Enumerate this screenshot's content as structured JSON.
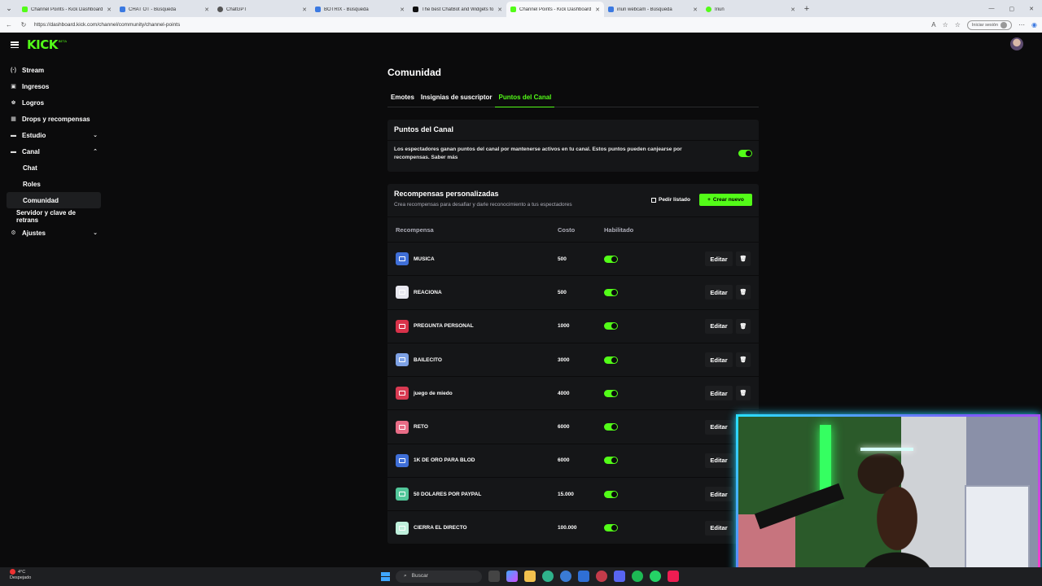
{
  "browser": {
    "tabs": [
      {
        "title": "Channel Points - Kick Dashboard",
        "icon": "kick"
      },
      {
        "title": "CHAT OT - Búsqueda",
        "icon": "bing"
      },
      {
        "title": "ChatGPT",
        "icon": "gpt"
      },
      {
        "title": "BOTRIX - Búsqueda",
        "icon": "bing"
      },
      {
        "title": "The best ChatBot and Widgets fo",
        "icon": "chat"
      },
      {
        "title": "Channel Points - Kick Dashboard",
        "icon": "kick",
        "active": true
      },
      {
        "title": "iriun webcam - Búsqueda",
        "icon": "bing"
      },
      {
        "title": "Iriun",
        "icon": "dot"
      }
    ],
    "url": "https://dashboard.kick.com/channel/community/channel-points",
    "signin_label": "Iniciar sesión"
  },
  "app": {
    "logo": "KICK",
    "logo_badge": "BETA"
  },
  "sidebar": {
    "items": [
      {
        "label": "Stream",
        "icon": "stream-icon",
        "glyph": "((·))"
      },
      {
        "label": "Ingresos",
        "icon": "revenue-icon",
        "glyph": "▣"
      },
      {
        "label": "Logros",
        "icon": "trophy-icon",
        "glyph": "🏆"
      },
      {
        "label": "Drops y recompensas",
        "icon": "drops-icon",
        "glyph": "▦"
      },
      {
        "label": "Estudio",
        "icon": "studio-icon",
        "glyph": "▬",
        "chevron": "down"
      },
      {
        "label": "Canal",
        "icon": "channel-icon",
        "glyph": "▬",
        "chevron": "up"
      },
      {
        "label": "Chat",
        "sub": true
      },
      {
        "label": "Roles",
        "sub": true
      },
      {
        "label": "Comunidad",
        "sub": true,
        "active": true
      },
      {
        "label": "Servidor y clave de retrans",
        "flat": true
      },
      {
        "label": "Ajustes",
        "icon": "settings-icon",
        "glyph": "⚙",
        "chevron": "down"
      }
    ]
  },
  "main": {
    "title": "Comunidad",
    "tabs": [
      {
        "label": "Emotes"
      },
      {
        "label": "Insignias de suscriptor"
      },
      {
        "label": "Puntos del Canal",
        "active": true
      }
    ],
    "points_card": {
      "title": "Puntos del Canal",
      "description": "Los espectadores ganan puntos del canal por mantenerse activos en tu canal. Estos puntos pueden canjearse por recompensas. Saber más",
      "enabled": true
    },
    "rewards_card": {
      "title": "Recompensas personalizadas",
      "subtitle": "Crea recompensas para desafiar y darle reconocimiento a tus espectadores",
      "request_list_label": "Pedir listado",
      "create_label": "Crear nuevo",
      "columns": {
        "reward": "Recompensa",
        "cost": "Costo",
        "enabled": "Habilitado"
      },
      "edit_label": "Editar",
      "rows": [
        {
          "name": "MUSICA",
          "cost": "500",
          "color": "#3f6fd8",
          "enabled": true,
          "deletable": true
        },
        {
          "name": "REACIONA",
          "cost": "500",
          "color": "#e8e8f0",
          "enabled": true,
          "deletable": true
        },
        {
          "name": "PREGUNTA PERSONAL",
          "cost": "1000",
          "color": "#d8324a",
          "enabled": true,
          "deletable": true
        },
        {
          "name": "BAILECITO",
          "cost": "3000",
          "color": "#7ea2e6",
          "enabled": true,
          "deletable": true
        },
        {
          "name": "juego de miedo",
          "cost": "4000",
          "color": "#d83a52",
          "enabled": true,
          "deletable": true
        },
        {
          "name": "RETO",
          "cost": "6000",
          "color": "#e86c86",
          "enabled": true,
          "deletable": false
        },
        {
          "name": "1K DE ORO PARA BLOD",
          "cost": "6000",
          "color": "#3f6fd8",
          "enabled": true,
          "deletable": false
        },
        {
          "name": "50 DOLARES POR PAYPAL",
          "cost": "15.000",
          "color": "#52c79a",
          "enabled": true,
          "deletable": false
        },
        {
          "name": "CIERRA EL DIRECTO",
          "cost": "100.000",
          "color": "#bff0dc",
          "enabled": true,
          "deletable": false
        }
      ]
    }
  },
  "taskbar": {
    "weather_temp": "4°C",
    "weather_desc": "Despejado",
    "search_placeholder": "Buscar"
  }
}
